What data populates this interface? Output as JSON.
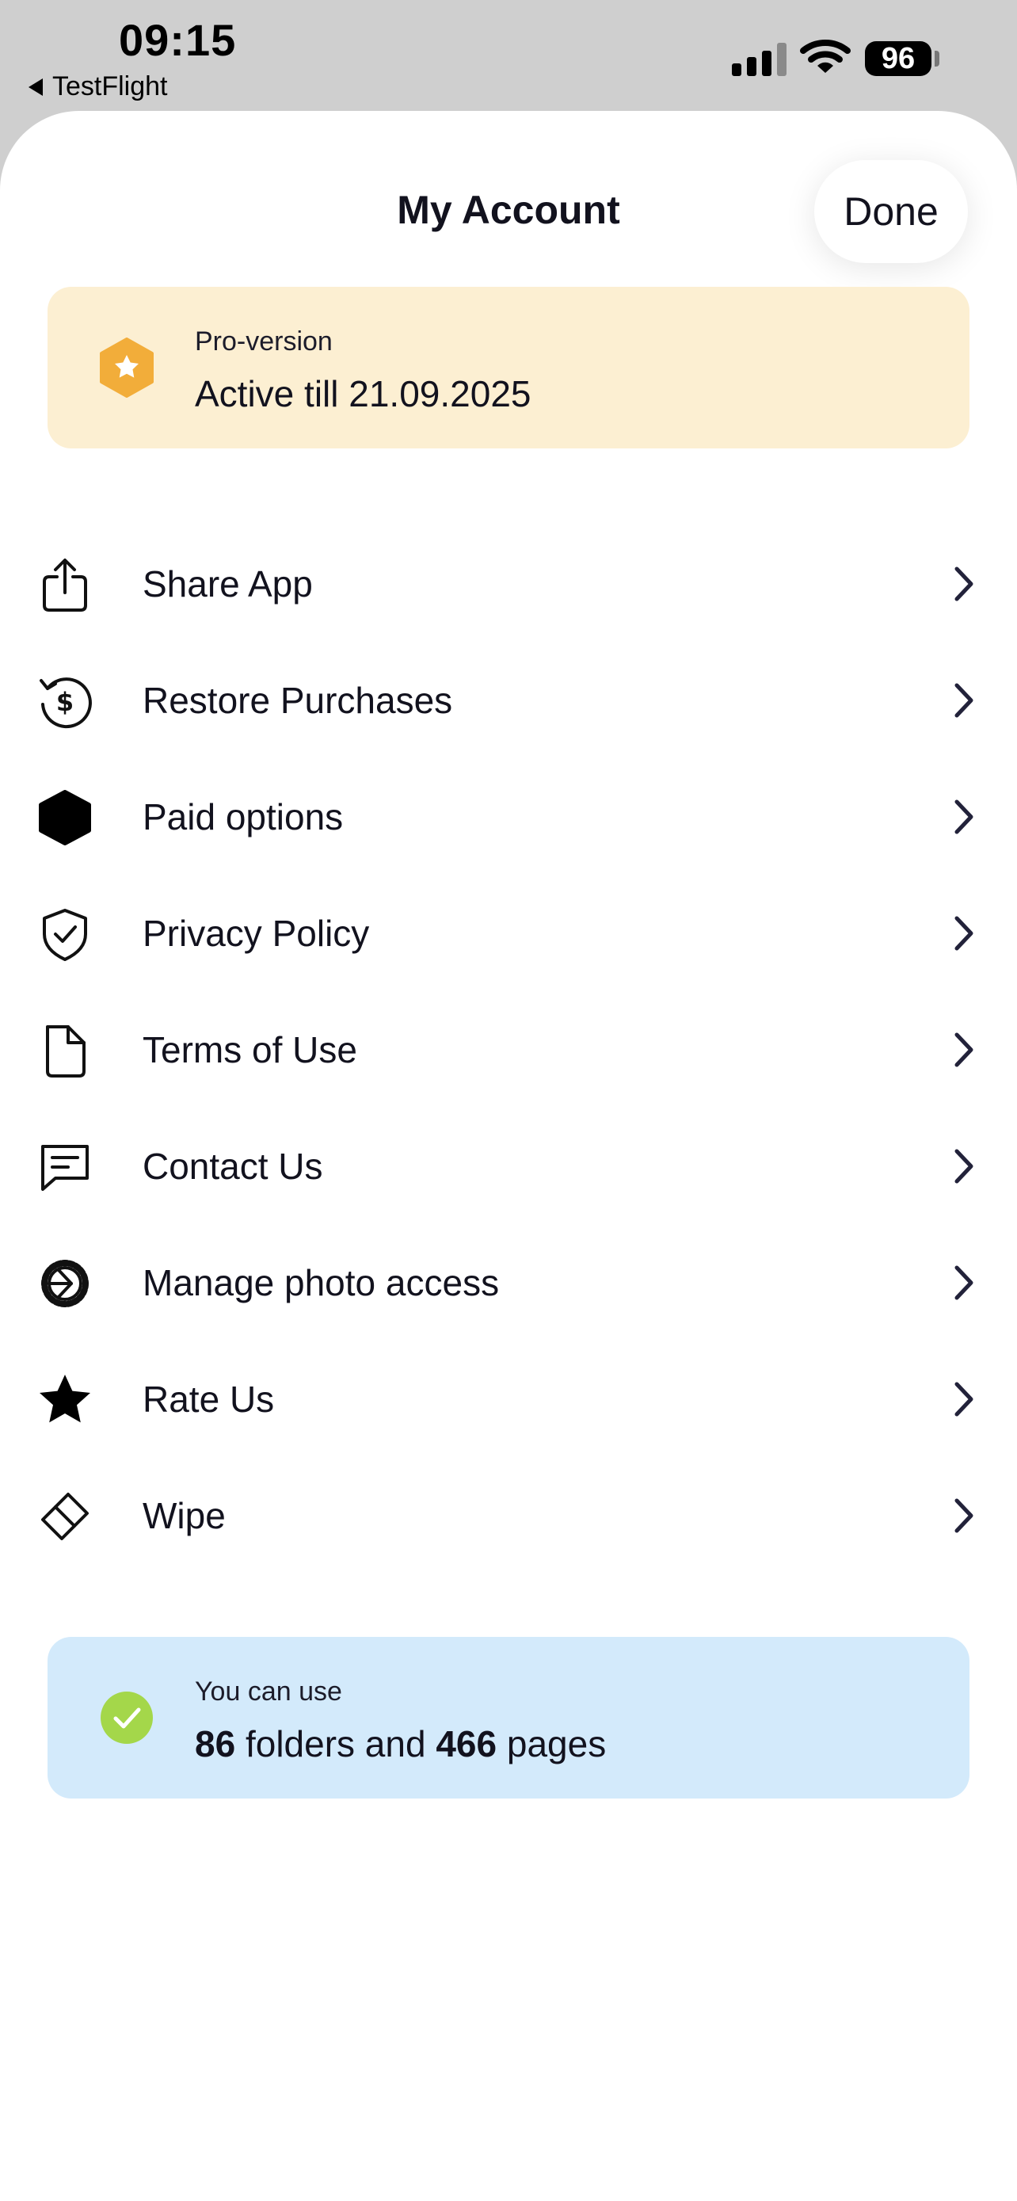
{
  "status_bar": {
    "time": "09:15",
    "back_app": "TestFlight",
    "battery": "96",
    "icons": [
      "cellular-signal-icon",
      "wifi-icon",
      "battery-icon"
    ]
  },
  "header": {
    "title": "My Account",
    "done_label": "Done"
  },
  "pro": {
    "label": "Pro-version",
    "value": "Active till 21.09.2025",
    "icon": "hexagon-star-icon",
    "icon_color": "#f2ad3a",
    "card_color": "#fcefd2"
  },
  "menu": {
    "items": [
      {
        "label": "Share App",
        "icon": "share-icon"
      },
      {
        "label": "Restore Purchases",
        "icon": "restore-dollar-icon"
      },
      {
        "label": "Paid options",
        "icon": "hexagon-icon"
      },
      {
        "label": "Privacy Policy",
        "icon": "shield-check-icon"
      },
      {
        "label": "Terms of Use",
        "icon": "document-icon"
      },
      {
        "label": "Contact Us",
        "icon": "message-icon"
      },
      {
        "label": "Manage photo access",
        "icon": "shutter-icon"
      },
      {
        "label": "Rate Us",
        "icon": "star-icon"
      },
      {
        "label": "Wipe",
        "icon": "eraser-icon"
      }
    ]
  },
  "usage": {
    "label": "You can use",
    "folders_count": "86",
    "folders_text": " folders and ",
    "pages_count": "466",
    "pages_text": " pages",
    "icon": "check-circle-icon",
    "icon_color": "#a4d74a",
    "card_color": "#d3eafb"
  }
}
